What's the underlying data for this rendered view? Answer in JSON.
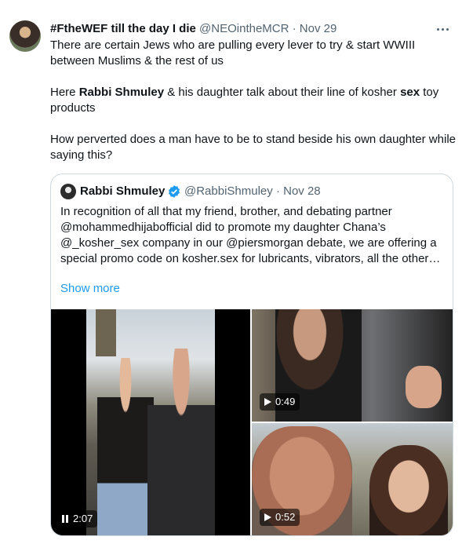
{
  "tweet": {
    "display_name": "#FtheWEF till the day I die",
    "handle": "@NEOintheMCR",
    "separator": "·",
    "date": "Nov 29",
    "more_icon": "more-horizontal-icon",
    "paragraph1": "There are certain Jews who are pulling every lever to try & start WWIII between Muslims & the rest of us",
    "paragraph2_part1": "Here ",
    "paragraph2_bold1": "Rabbi Shmuley",
    "paragraph2_part2": " & his daughter talk about their line of kosher ",
    "paragraph2_bold2": "sex",
    "paragraph2_part3": " toy products",
    "paragraph3": "How perverted does a man have to be to stand beside his own daughter while saying this?"
  },
  "quoted_tweet": {
    "display_name": "Rabbi Shmuley",
    "verified_icon": "verified-badge-icon",
    "verified_color": "#1d9bf0",
    "handle": "@RabbiShmuley",
    "separator": "·",
    "date": "Nov 28",
    "text": "In recognition of all that my friend, brother, and debating partner @mohammedhijabofficial did to promote my daughter Chana’s @_kosher_sex company in our @piersmorgan debate, we are offering a special promo code on kosher.sex for lubricants, vibrators, all the other…",
    "show_more_label": "Show more"
  },
  "media": {
    "videos": [
      {
        "duration": "2:07",
        "state_icon": "pause-icon"
      },
      {
        "duration": "0:49",
        "state_icon": "play-icon"
      },
      {
        "duration": "0:52",
        "state_icon": "play-icon"
      }
    ]
  },
  "colors": {
    "link": "#1d9bf0",
    "secondary_text": "#536471",
    "border": "#cfd9de"
  }
}
